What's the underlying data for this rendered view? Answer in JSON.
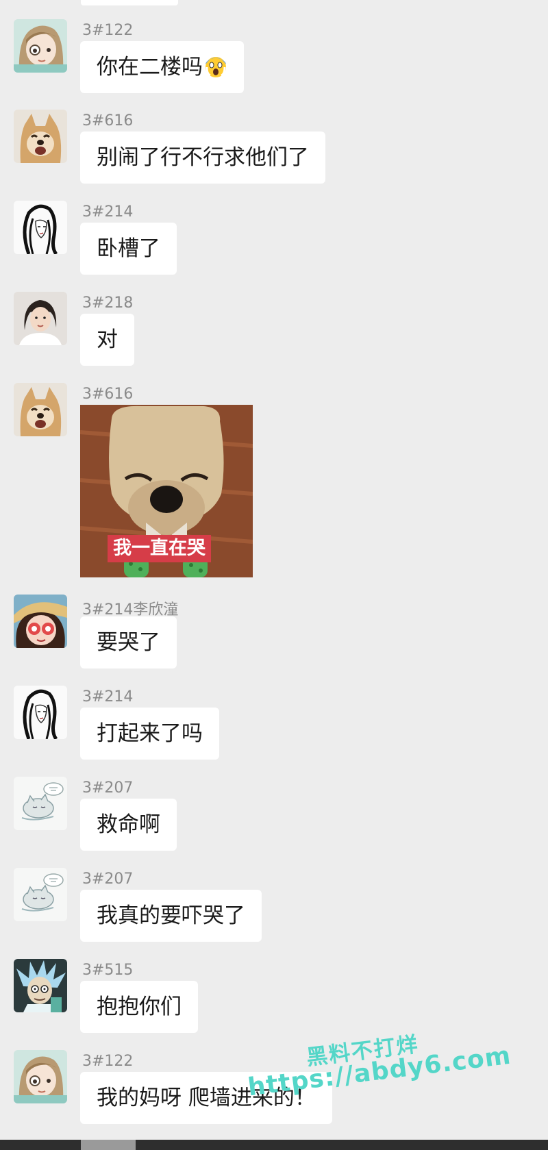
{
  "messages": [
    {
      "sender": "3#122",
      "text": "你在二楼吗",
      "avatar": "anime-avatar",
      "emoji": "scream-face"
    },
    {
      "sender": "3#616",
      "text": "别闹了行不行求他们了",
      "avatar": "shiba-dog-avatar"
    },
    {
      "sender": "3#214",
      "text": "卧槽了",
      "avatar": "sketch-girl-avatar"
    },
    {
      "sender": "3#218",
      "text": "对",
      "avatar": "girl-photo-avatar"
    },
    {
      "sender": "3#616",
      "sticker_caption": "我一直在哭",
      "avatar": "shiba-dog-avatar"
    },
    {
      "sender": "3#214李欣潼",
      "text": "要哭了",
      "avatar": "cartoon-girl-avatar"
    },
    {
      "sender": "3#214",
      "text": "打起来了吗",
      "avatar": "sketch-girl-avatar"
    },
    {
      "sender": "3#207",
      "text": "救命啊",
      "avatar": "sleepy-cat-sketch-avatar"
    },
    {
      "sender": "3#207",
      "text": "我真的要吓哭了",
      "avatar": "sleepy-cat-sketch-avatar"
    },
    {
      "sender": "3#515",
      "text": "抱抱你们",
      "avatar": "rick-cartoon-avatar"
    },
    {
      "sender": "3#122",
      "text": "我的妈呀  爬墙进来的！",
      "avatar": "anime-avatar"
    }
  ],
  "watermark": {
    "line1": "黑料不打烊",
    "line2": "https://abdy6.com"
  },
  "colors": {
    "background": "#ededed",
    "bubble": "#ffffff",
    "sender_text": "#8a8a8a",
    "watermark": "#54d6c8",
    "sticker_caption_bg": "#d63d48"
  }
}
